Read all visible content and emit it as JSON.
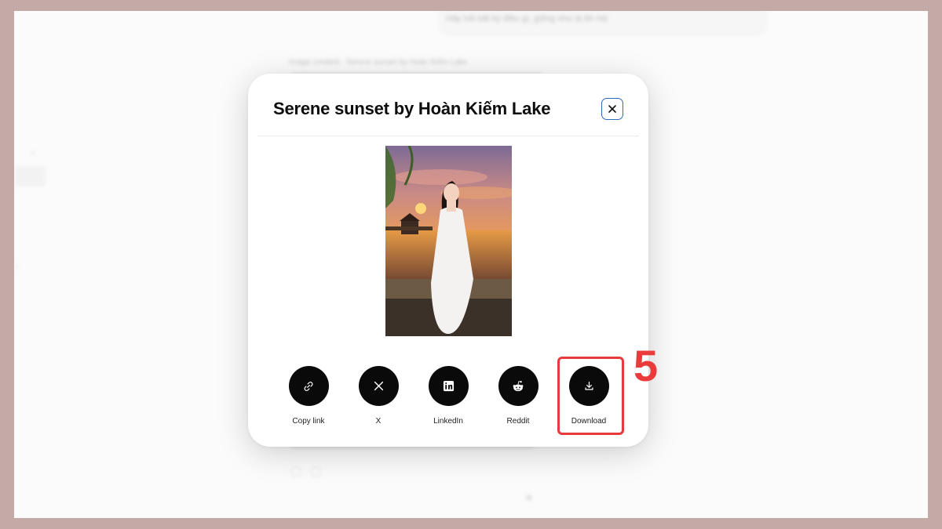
{
  "background": {
    "top_input_placeholder": "Hãy hỏi bất kỳ điều gì, giống như là lời nói",
    "created_line": "Image created · Serene sunset by Hoàn Kiếm Lake"
  },
  "modal": {
    "title": "Serene sunset by Hoàn Kiếm Lake",
    "close_label": "×"
  },
  "share": [
    {
      "label": "Copy link",
      "icon": "link-icon"
    },
    {
      "label": "X",
      "icon": "x-logo-icon"
    },
    {
      "label": "LinkedIn",
      "icon": "linkedin-icon"
    },
    {
      "label": "Reddit",
      "icon": "reddit-icon"
    },
    {
      "label": "Download",
      "icon": "download-icon"
    }
  ],
  "annotation": {
    "step_number": "5",
    "color": "#ea3b3c"
  }
}
